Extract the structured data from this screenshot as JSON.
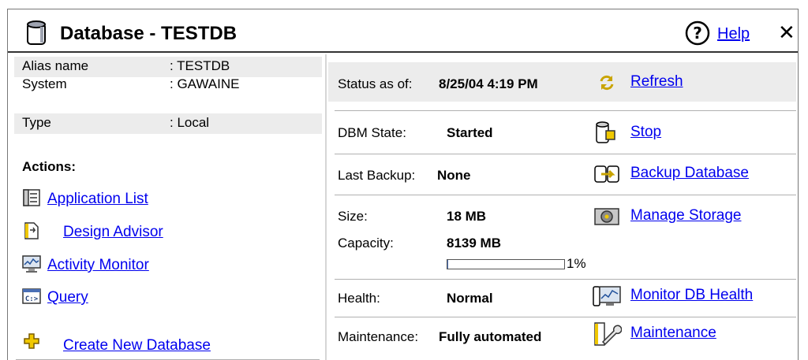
{
  "window": {
    "title": "Database - TESTDB",
    "help_label": "Help",
    "close_glyph": "✕"
  },
  "info": [
    {
      "label": "Alias name",
      "value": ": TESTDB"
    },
    {
      "label": "System",
      "value": ": GAWAINE"
    },
    {
      "label": "Type",
      "value": ": Local"
    }
  ],
  "actions": {
    "heading": "Actions:",
    "items": [
      {
        "label": "Application List",
        "icon": "application-list-icon"
      },
      {
        "label": "Design Advisor",
        "icon": "design-advisor-icon"
      },
      {
        "label": "Activity Monitor",
        "icon": "activity-monitor-icon"
      },
      {
        "label": "Query",
        "icon": "query-icon"
      }
    ],
    "create": {
      "label": "Create New Database",
      "icon": "create-icon"
    }
  },
  "status": {
    "as_of_label": "Status as of:",
    "as_of_value": "8/25/04 4:19 PM",
    "refresh_label": "Refresh",
    "dbm_label": "DBM State:",
    "dbm_value": "Started",
    "stop_label": "Stop",
    "backup_label": "Last Backup:",
    "backup_value": "None",
    "backup_action": "Backup Database",
    "size_label": "Size:",
    "size_value": "18 MB",
    "storage_action": "Manage Storage",
    "capacity_label": "Capacity:",
    "capacity_value": "8139 MB",
    "usage_percent": 1,
    "usage_text": "1%",
    "health_label": "Health:",
    "health_value": "Normal",
    "health_action": "Monitor DB Health",
    "maint_label": "Maintenance:",
    "maint_value": "Fully automated",
    "maint_action": "Maintenance"
  },
  "colors": {
    "link": "#0000ee",
    "band": "#ececec",
    "icon_yellow": "#f0c800"
  }
}
